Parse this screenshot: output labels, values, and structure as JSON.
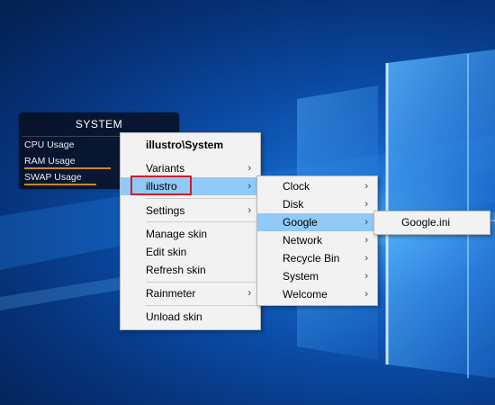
{
  "widget": {
    "title": "SYSTEM",
    "rows": [
      {
        "label": "CPU Usage"
      },
      {
        "label": "RAM Usage"
      },
      {
        "label": "SWAP Usage"
      }
    ]
  },
  "context_menu": {
    "header": "illustro\\System",
    "items": {
      "variants": "Variants",
      "illustro": "illustro",
      "settings": "Settings",
      "manage_skin": "Manage skin",
      "edit_skin": "Edit skin",
      "refresh_skin": "Refresh skin",
      "rainmeter": "Rainmeter",
      "unload_skin": "Unload skin"
    },
    "submenu_arrow": "›"
  },
  "illustro_submenu": {
    "items": [
      "Clock",
      "Disk",
      "Google",
      "Network",
      "Recycle Bin",
      "System",
      "Welcome"
    ],
    "highlighted": "Google"
  },
  "google_submenu": {
    "items": [
      "Google.ini"
    ]
  },
  "colors": {
    "highlight": "#91c9f7",
    "annotation_box": "#d7182a",
    "meter_bar": "#c98a1f"
  }
}
